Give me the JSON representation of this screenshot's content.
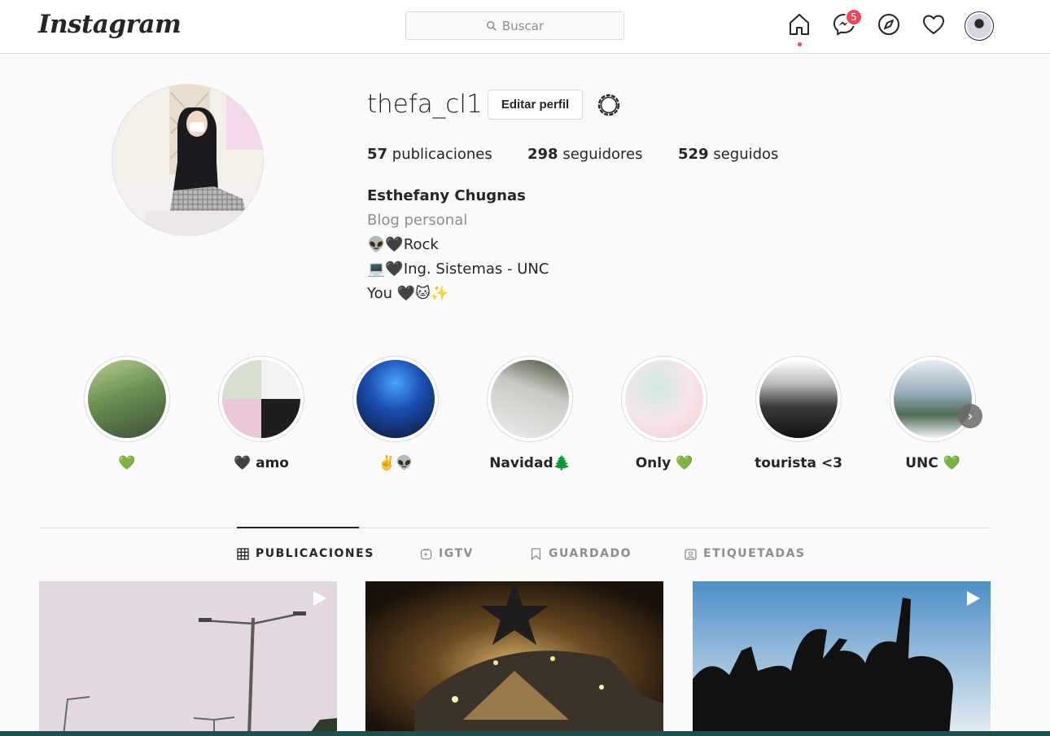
{
  "brand": {
    "logo": "Instagram"
  },
  "search": {
    "placeholder": "Buscar"
  },
  "nav": {
    "messenger_badge": "5"
  },
  "profile": {
    "username": "thefa_cl1",
    "edit_label": "Editar perfil",
    "stats": {
      "posts_count": "57",
      "posts_label": "publicaciones",
      "followers_count": "298",
      "followers_label": "seguidores",
      "following_count": "529",
      "following_label": "seguidos"
    },
    "full_name": "Esthefany Chugnas",
    "category": "Blog personal",
    "bio": [
      "👽🖤Rock",
      "💻🖤Ing. Sistemas - UNC",
      "You 🖤🐱✨"
    ]
  },
  "highlights": [
    {
      "label": "💚"
    },
    {
      "label": "🖤 amo"
    },
    {
      "label": "✌️👽"
    },
    {
      "label": "Navidad🌲"
    },
    {
      "label": "Only 💚"
    },
    {
      "label": "tourista <3"
    },
    {
      "label": "UNC 💚"
    }
  ],
  "tabs": [
    {
      "label": "PUBLICACIONES",
      "icon": "grid-icon",
      "active": true
    },
    {
      "label": "IGTV",
      "icon": "igtv-icon",
      "active": false
    },
    {
      "label": "GUARDADO",
      "icon": "bookmark-icon",
      "active": false
    },
    {
      "label": "ETIQUETADAS",
      "icon": "tagged-icon",
      "active": false
    }
  ],
  "colors": {
    "badge": "#ed4956",
    "border": "#dbdbdb",
    "muted": "#8e8e8e",
    "text": "#262626"
  }
}
